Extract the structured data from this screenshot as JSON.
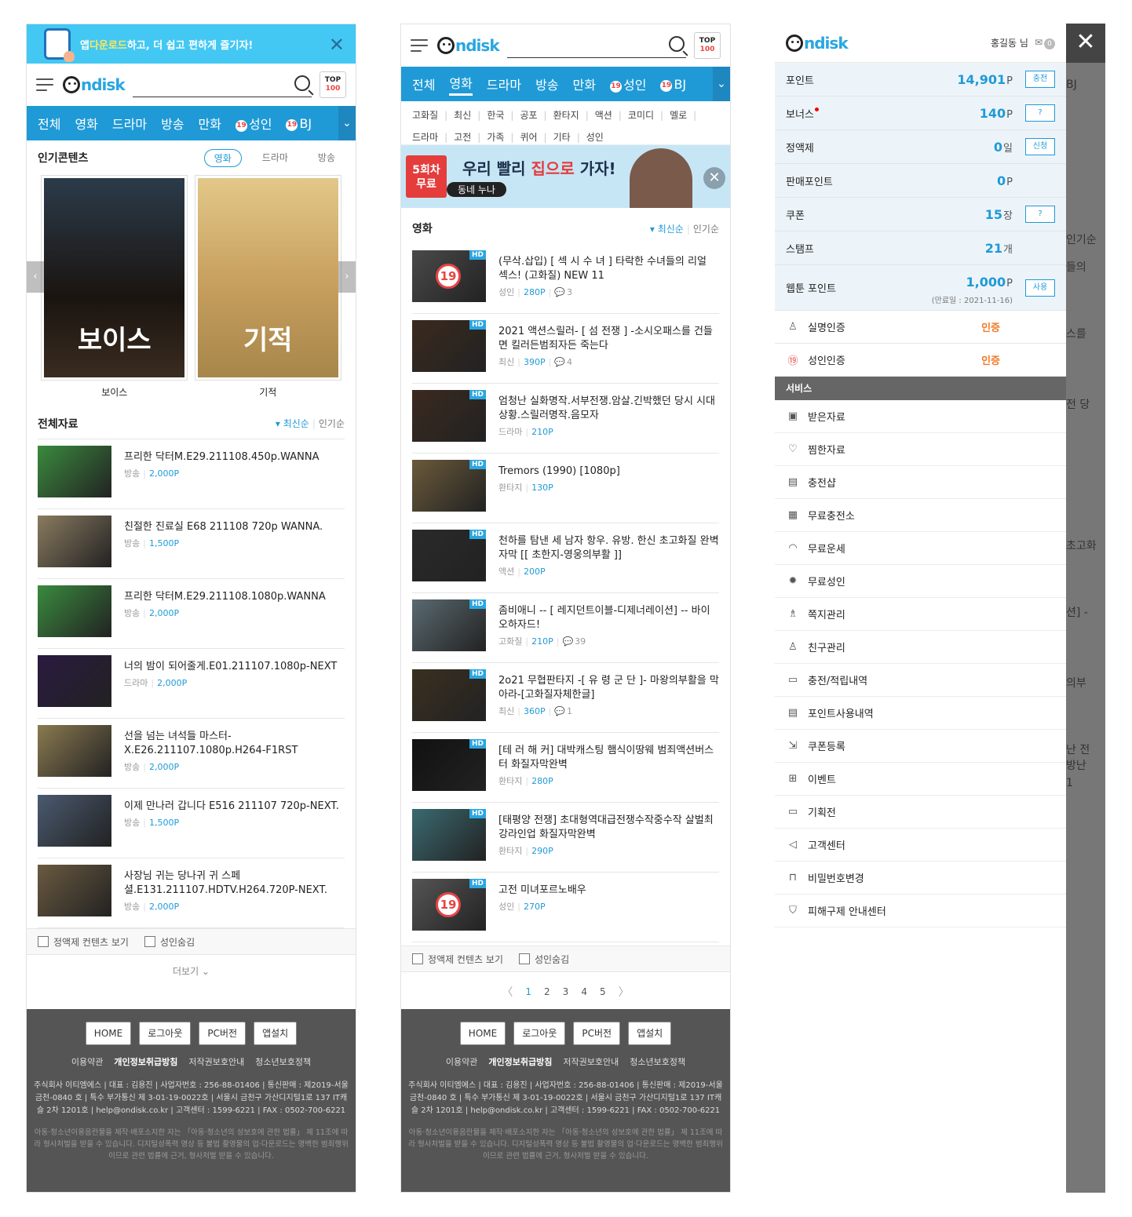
{
  "p1": {
    "banner_text_pre": "앱 ",
    "banner_text_hl": "다운로드",
    "banner_text_post": "하고, 더 쉽고 편하게 즐기자!",
    "banner_close": "✕",
    "logo_n": "ndisk",
    "top_label": "TOP",
    "top_num": "100",
    "nav": [
      "전체",
      "영화",
      "드라마",
      "방송",
      "만화",
      "성인",
      "BJ"
    ],
    "badge19": "19",
    "nav_more": "⌄",
    "popular_title": "인기콘텐츠",
    "popular_tabs": [
      "영화",
      "드라마",
      "방송"
    ],
    "posters": [
      {
        "title": "보이스",
        "img_text": "보이스"
      },
      {
        "title": "기적",
        "img_text": "기적"
      }
    ],
    "all_title": "전체자료",
    "sort_new": "▾ 최신순",
    "sort_sep": "|",
    "sort_pop": "인기순",
    "items": [
      {
        "title": "프리한 닥터M.E29.211108.450p.WANNA",
        "cat": "방송",
        "point": "2,000P"
      },
      {
        "title": "친절한 진료실 E68 211108 720p WANNA.",
        "cat": "방송",
        "point": "1,500P"
      },
      {
        "title": "프리한 닥터M.E29.211108.1080p.WANNA",
        "cat": "방송",
        "point": "2,000P"
      },
      {
        "title": "너의 밤이 되어줄게.E01.211107.1080p-NEXT",
        "cat": "드라마",
        "point": "2,000P"
      },
      {
        "title": "선을 넘는 녀석들 마스터-X.E26.211107.1080p.H264-F1RST",
        "cat": "방송",
        "point": "2,000P"
      },
      {
        "title": "이제 만나러 갑니다 E516 211107 720p-NEXT.",
        "cat": "방송",
        "point": "1,500P"
      },
      {
        "title": "사장님 귀는 당나귀 귀 스페셜.E131.211107.HDTV.H264.720P-NEXT.",
        "cat": "방송",
        "point": "2,000P"
      }
    ],
    "check1": "정액제 컨텐츠 보기",
    "check2": "성인숨김",
    "more": "더보기 ⌄"
  },
  "p2": {
    "nav": [
      "전체",
      "영화",
      "드라마",
      "방송",
      "만화",
      "성인",
      "BJ"
    ],
    "genres1": [
      "고화질",
      "최신",
      "한국",
      "공포",
      "환타지",
      "액션",
      "코미디",
      "멜로"
    ],
    "genres2": [
      "드라마",
      "고전",
      "가족",
      "퀴어",
      "기타",
      "성인"
    ],
    "ad_badge_top": "5회차",
    "ad_badge_bottom": "무료",
    "ad_text_pre": "우리 빨리 ",
    "ad_text_hl": "집으로",
    "ad_text_post": " 가자!",
    "ad_sub": "동네 누나",
    "ad_close": "✕",
    "section_title": "영화",
    "items": [
      {
        "title": "(무삭.삽입) [ 섹 시 수 녀 ] 타락한 수녀들의 리얼 섹스! (고화질) NEW 11",
        "cat": "성인",
        "point": "280P",
        "comments": "3",
        "r19": true
      },
      {
        "title": "2021 액션스릴러- [ 섬 전쟁 ] -소시오패스를 건들면 킬러든범죄자든 죽는다",
        "cat": "최신",
        "point": "390P",
        "comments": "4",
        "r19": false
      },
      {
        "title": "엄청난 실화명작.서부전쟁.암살.긴박했던 당시 시대상황.스릴러명작.음모자",
        "cat": "드라마",
        "point": "210P",
        "comments": "",
        "r19": false
      },
      {
        "title": "Tremors (1990) [1080p]",
        "cat": "환타지",
        "point": "130P",
        "comments": "",
        "r19": false
      },
      {
        "title": "천하를 탐낸 세 남자 항우. 유방. 한신 초고화질 완벽자막 [[ 초한지-영웅의부활 ]]",
        "cat": "액션",
        "point": "200P",
        "comments": "",
        "r19": false
      },
      {
        "title": "좀비애니 -- [ 레지던트이블-디제너레이션] -- 바이오하자드!",
        "cat": "고화질",
        "point": "210P",
        "comments": "39",
        "r19": false
      },
      {
        "title": "2o21 무협판타지 -[ 유 령 군 단 ]- 마왕의부활을 막아라-[고화질자체한글]",
        "cat": "최신",
        "point": "360P",
        "comments": "1",
        "r19": false
      },
      {
        "title": "[테 러 해 커] 대박캐스팅 햄식이땅웨 범죄액션버스터 화질자막완벽",
        "cat": "환타지",
        "point": "280P",
        "comments": "",
        "r19": false
      },
      {
        "title": "[태평양 전쟁] 초대형역대급전쟁수작중수작 살벌최강라인업 화질자막완벽",
        "cat": "환타지",
        "point": "290P",
        "comments": "",
        "r19": false
      },
      {
        "title": "고전 미녀포르노배우",
        "cat": "성인",
        "point": "270P",
        "comments": "",
        "r19": true
      }
    ],
    "pages": [
      "1",
      "2",
      "3",
      "4",
      "5"
    ],
    "prev": "〈",
    "next": "〉"
  },
  "p3": {
    "user": "홍길동 님",
    "msg_count": "0",
    "close": "✕",
    "points": [
      {
        "label": "포인트",
        "value": "14,901",
        "unit": "P",
        "btn": "충전"
      },
      {
        "label": "보너스",
        "value": "140",
        "unit": "P",
        "btn": "?",
        "dot": true
      },
      {
        "label": "정액제",
        "value": "0",
        "unit": "일",
        "btn": "신청"
      },
      {
        "label": "판매포인트",
        "value": "0",
        "unit": "P",
        "btn": ""
      },
      {
        "label": "쿠폰",
        "value": "15",
        "unit": "장",
        "btn": "?"
      },
      {
        "label": "스탬프",
        "value": "21",
        "unit": "개",
        "btn": ""
      }
    ],
    "webtoon_label": "웹툰 포인트",
    "webtoon_value": "1,000",
    "webtoon_unit": "P",
    "webtoon_btn": "사용",
    "webtoon_exp": "(만료일 : 2021-11-16)",
    "cert": [
      {
        "label": "실명인증",
        "status": "인증",
        "icon": "person-icon"
      },
      {
        "label": "성인인증",
        "status": "인증",
        "icon": "adult-icon"
      }
    ],
    "svc_head": "서비스",
    "services": [
      "받은자료",
      "찜한자료",
      "충전샵",
      "무료충전소",
      "무료운세",
      "무료성인",
      "쪽지관리",
      "친구관리",
      "충전/적립내역",
      "포인트사용내역",
      "쿠폰등록",
      "이벤트",
      "기획전",
      "고객센터",
      "비밀번호변경",
      "피해구제 안내센터"
    ],
    "bg_texts": [
      "BJ",
      "인기순",
      "들의",
      "스를",
      "전 당",
      "초고화",
      "션] -",
      "의부",
      "난 전",
      "방난",
      "1"
    ]
  },
  "footer": {
    "buttons": [
      "HOME",
      "로그아웃",
      "PC버전",
      "앱설치"
    ],
    "links": [
      "이용약관",
      "개인정보취급방침",
      "저작권보호안내",
      "청소년보호정책"
    ],
    "address": "주식회사 이티엠에스 | 대표 : 김용진 | 사업자번호 : 256-88-01406 | 통신판매 : 제2019-서울금천-0840 호 | 특수 부가통신 제 3-01-19-0022호 | 서울시 금천구 가산디지털1로 137 IT캐슬 2차 1201호 | help@ondisk.co.kr | 고객센터 : 1599-6221 | FAX : 0502-700-6221",
    "warning": "아동·청소년이용음란물을 제작·배포소지한 자는 「아동·청소년의 성보호에 관한 법률」 제 11조에 따라 형사처벌을 받을 수 있습니다. 디지털성폭력 영상 등 불법 촬영물의 업·다운로드는 명백한 범죄행위이므로 관련 법률에 근거, 형사처벌 받을 수 있습니다."
  },
  "colors": {
    "accent": "#1f9ad6",
    "banner": "#43c8f4",
    "footer": "#555555",
    "badge": "#e64545"
  }
}
